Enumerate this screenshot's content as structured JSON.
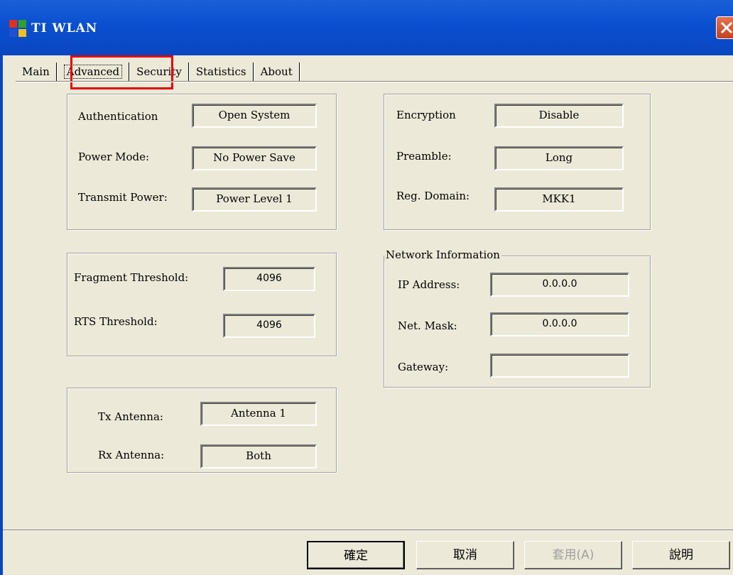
{
  "window": {
    "title": "TI WLAN"
  },
  "tabs": [
    {
      "label": "Main"
    },
    {
      "label": "Advanced"
    },
    {
      "label": "Security"
    },
    {
      "label": "Statistics"
    },
    {
      "label": "About"
    }
  ],
  "radio_settings": {
    "authentication_label": "Authentication",
    "authentication_value": "Open System",
    "power_mode_label": "Power Mode:",
    "power_mode_value": "No Power Save",
    "transmit_power_label": "Transmit Power:",
    "transmit_power_value": "Power Level 1"
  },
  "security_settings": {
    "encryption_label": "Encryption",
    "encryption_value": "Disable",
    "preamble_label": "Preamble:",
    "preamble_value": "Long",
    "reg_domain_label": "Reg. Domain:",
    "reg_domain_value": "MKK1"
  },
  "thresholds": {
    "fragment_label": "Fragment Threshold:",
    "fragment_value": "4096",
    "rts_label": "RTS Threshold:",
    "rts_value": "4096"
  },
  "network_info": {
    "legend": "Network Information",
    "ip_label": "IP Address:",
    "ip_value": "0.0.0.0",
    "mask_label": "Net. Mask:",
    "mask_value": "0.0.0.0",
    "gateway_label": "Gateway:",
    "gateway_value": ""
  },
  "antenna": {
    "tx_label": "Tx Antenna:",
    "tx_value": "Antenna 1",
    "rx_label": "Rx Antenna:",
    "rx_value": "Both"
  },
  "buttons": {
    "ok": "確定",
    "cancel": "取消",
    "apply": "套用(A)",
    "help": "說明"
  }
}
